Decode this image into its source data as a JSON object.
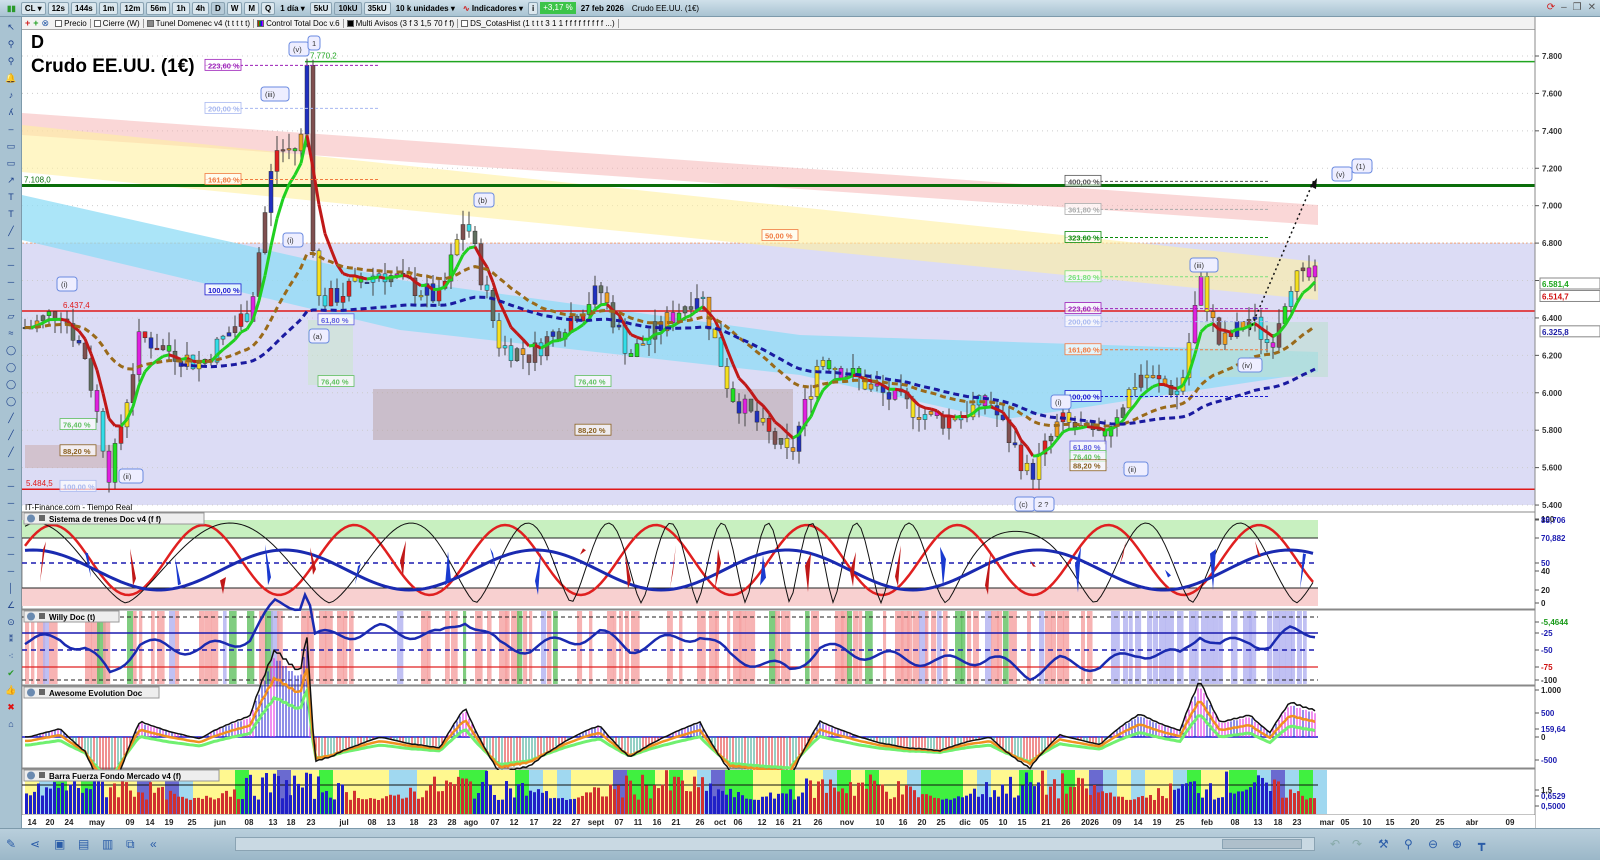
{
  "toolbar": {
    "symbol": "CL",
    "intervals": [
      "12s",
      "144s",
      "1m",
      "12m",
      "56m",
      "1h",
      "4h",
      "D",
      "W",
      "M",
      "Q"
    ],
    "period": "1 día",
    "units": [
      "5kU",
      "10kU",
      "35kU"
    ],
    "units_select": "10 k unidades",
    "indicators_label": "Indicadores",
    "change": "+3,17 %",
    "date": "27 feb 2026",
    "title": "Crudo EE.UU. (1€)"
  },
  "tags": [
    "Precio",
    "Cierre (W)",
    "Tunel Domenec v4 (t t t t t)",
    "Control Total Doc v.6",
    "Multi Avisos (3 f 3 1,5 70 f f)",
    "DS_CotasHist (1 t t t 3 1 1 f f f f f f f f f ...)"
  ],
  "main": {
    "timeframe": "D",
    "instrument": "Crudo EE.UU. (1€)",
    "source": "IT-Finance.com - Tiempo Real",
    "price_ticks": [
      "7.800",
      "7.600",
      "7.400",
      "7.200",
      "7.000",
      "6.800",
      "6.600",
      "6.400",
      "6.200",
      "6.000",
      "5.800",
      "5.600",
      "5.400"
    ],
    "price_tick_values": [
      7.8,
      7.6,
      7.4,
      7.2,
      7.0,
      6.8,
      6.6,
      6.4,
      6.2,
      6.0,
      5.8,
      5.6,
      5.4
    ],
    "price_badges": [
      {
        "text": "6.581,4",
        "value": 6.5814,
        "color": "#1aa51a"
      },
      {
        "text": "6.514,7",
        "value": 6.5147,
        "color": "#d01010"
      },
      {
        "text": "6.325,8",
        "value": 6.3258,
        "color": "#1a1aa5"
      }
    ],
    "levels": [
      {
        "text": "7.770,2",
        "value": 7.7702,
        "color": "#1fa51f"
      },
      {
        "text": "7.108,0",
        "value": 7.108,
        "color": "#0a6e0a"
      },
      {
        "text": "6.437,4",
        "value": 6.4374,
        "color": "#e01818"
      },
      {
        "text": "5.484,5",
        "value": 5.4845,
        "color": "#e01818"
      }
    ],
    "fib_labels": [
      {
        "text": "223,60 %",
        "value": 7.75,
        "color": "#9b1fb8"
      },
      {
        "text": "200,00 %",
        "value": 7.52,
        "color": "#a8b8f0"
      },
      {
        "text": "161,80 %",
        "value": 7.14,
        "color": "#f07a40"
      },
      {
        "text": "100,00 %",
        "value": 6.55,
        "color": "#1a1ad0"
      },
      {
        "text": "61,80 %",
        "value": 6.39,
        "color": "#6060e0"
      },
      {
        "text": "76,40 %",
        "value": 6.06,
        "color": "#60c060"
      },
      {
        "text": "76,40 %",
        "value": 5.83,
        "color": "#60c060"
      },
      {
        "text": "88,20 %",
        "value": 5.69,
        "color": "#8a6020"
      },
      {
        "text": "100,00 %",
        "value": 5.5,
        "color": "#a8b8f0"
      },
      {
        "text": "50,00 %",
        "value": 6.84,
        "color": "#f07a40"
      },
      {
        "text": "76,40 %",
        "value": 6.06,
        "color": "#60c060"
      },
      {
        "text": "88,20 %",
        "value": 5.8,
        "color": "#8a6020"
      },
      {
        "text": "400,00 %",
        "value": 7.13,
        "color": "#555"
      },
      {
        "text": "361,80 %",
        "value": 6.98,
        "color": "#aaa"
      },
      {
        "text": "323,60 %",
        "value": 6.83,
        "color": "#0a8a0a"
      },
      {
        "text": "261,80 %",
        "value": 6.62,
        "color": "#7ae07a"
      },
      {
        "text": "223,60 %",
        "value": 6.45,
        "color": "#9b1fb8"
      },
      {
        "text": "200,00 %",
        "value": 6.38,
        "color": "#a8b8f0"
      },
      {
        "text": "161,80 %",
        "value": 6.23,
        "color": "#f07a40"
      },
      {
        "text": "100,00 %",
        "value": 5.98,
        "color": "#1a1ad0"
      },
      {
        "text": "61,80 %",
        "value": 5.71,
        "color": "#6060e0"
      },
      {
        "text": "76,40 %",
        "value": 5.66,
        "color": "#60c060"
      },
      {
        "text": "88,20 %",
        "value": 5.61,
        "color": "#8a6020"
      }
    ],
    "wave_labels": [
      "(v)",
      "1",
      "(iii)",
      "(i)",
      "(ii)",
      "(a)",
      "(b)",
      "(i)",
      "(iv)",
      "(iii)",
      "(i)",
      "(ii)",
      "(c)",
      "2 ?",
      "(v)",
      "(1)"
    ],
    "price_path": [
      [
        30,
        6.35
      ],
      [
        60,
        6.45
      ],
      [
        85,
        6.2
      ],
      [
        110,
        5.55
      ],
      [
        140,
        6.3
      ],
      [
        200,
        6.15
      ],
      [
        250,
        6.45
      ],
      [
        275,
        7.3
      ],
      [
        300,
        7.3
      ],
      [
        307,
        7.75
      ],
      [
        315,
        6.5
      ],
      [
        330,
        6.5
      ],
      [
        380,
        6.65
      ],
      [
        420,
        6.55
      ],
      [
        440,
        6.5
      ],
      [
        465,
        6.95
      ],
      [
        500,
        6.25
      ],
      [
        530,
        6.2
      ],
      [
        600,
        6.55
      ],
      [
        630,
        6.2
      ],
      [
        700,
        6.55
      ],
      [
        730,
        6.0
      ],
      [
        790,
        5.65
      ],
      [
        820,
        6.2
      ],
      [
        880,
        6.0
      ],
      [
        940,
        5.85
      ],
      [
        990,
        5.95
      ],
      [
        1030,
        5.55
      ],
      [
        1060,
        5.85
      ],
      [
        1100,
        5.75
      ],
      [
        1140,
        6.1
      ],
      [
        1180,
        6.0
      ],
      [
        1200,
        6.6
      ],
      [
        1220,
        6.25
      ],
      [
        1250,
        6.4
      ],
      [
        1270,
        6.25
      ],
      [
        1290,
        6.6
      ],
      [
        1316,
        6.62
      ]
    ]
  },
  "panels": [
    {
      "title": "Sistema de trenes Doc v4 (f f)",
      "ticks": [
        "100",
        "88,706",
        "70,882",
        "50",
        "40",
        "20",
        "0"
      ]
    },
    {
      "title": "Willy Doc (t)",
      "ticks": [
        "-5,4644",
        "-25",
        "-50",
        "-75",
        "-100"
      ]
    },
    {
      "title": "Awesome Evolution Doc",
      "ticks": [
        "1.000",
        "500",
        "159,64",
        "0",
        "-500"
      ]
    },
    {
      "title": "Barra Fuerza Fondo Mercado v4 (f)",
      "ticks": [
        "1,5",
        "0,6529",
        "0,5000"
      ]
    }
  ],
  "dates": [
    "14",
    "20",
    "24",
    "may",
    "09",
    "14",
    "19",
    "25",
    "jun",
    "08",
    "13",
    "18",
    "23",
    "jul",
    "08",
    "13",
    "18",
    "23",
    "28",
    "ago",
    "07",
    "12",
    "17",
    "22",
    "27",
    "sept",
    "07",
    "11",
    "16",
    "21",
    "26",
    "oct",
    "06",
    "12",
    "16",
    "21",
    "26",
    "nov",
    "10",
    "16",
    "20",
    "25",
    "dic",
    "05",
    "10",
    "15",
    "21",
    "26",
    "2026",
    "09",
    "14",
    "19",
    "25",
    "feb",
    "08",
    "13",
    "18",
    "23",
    "mar",
    "05",
    "10",
    "15",
    "20",
    "25",
    "abr",
    "09"
  ]
}
